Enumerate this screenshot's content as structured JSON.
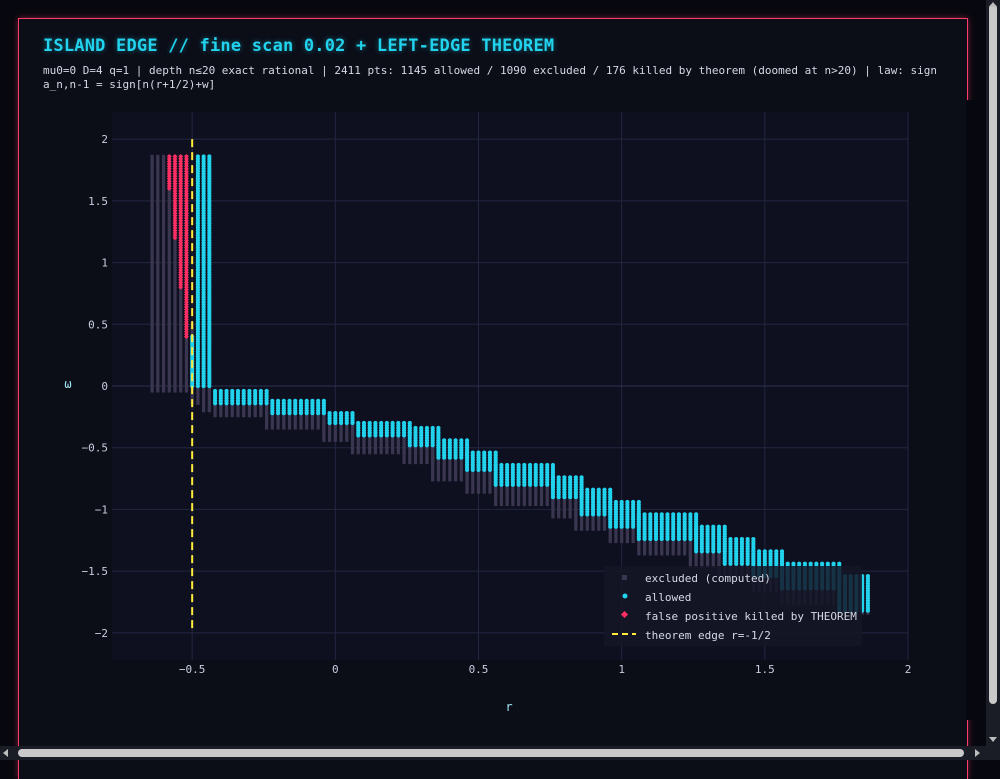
{
  "header": {
    "title": "ISLAND EDGE // fine scan 0.02 + LEFT-EDGE THEOREM",
    "subtitle": "mu0=0 D=4 q=1 | depth n≤20 exact rational | 2411 pts: 1145 allowed / 1090 excluded / 176 killed by theorem (doomed at n>20) | law: sign a_n,n-1 = sign[n(r+1/2)+w]"
  },
  "colors": {
    "excluded": "#3a3650",
    "allowed": "#22d3ee",
    "killed": "#ff2e63",
    "theorem": "#ffeb3b",
    "accent": "#ff3b6b"
  },
  "chart_data": {
    "type": "scatter",
    "title": "ISLAND EDGE // fine scan 0.02 + LEFT-EDGE THEOREM",
    "xlabel": "r",
    "ylabel": "ω",
    "xlim": [
      -0.78,
      2.0
    ],
    "ylim": [
      -2.22,
      2.22
    ],
    "x_ticks": [
      -0.5,
      0,
      0.5,
      1,
      1.5,
      2
    ],
    "x_tick_labels": [
      "−0.5",
      "0",
      "0.5",
      "1",
      "1.5",
      "2"
    ],
    "y_ticks": [
      -2,
      -1.5,
      -1,
      -0.5,
      0,
      0.5,
      1,
      1.5,
      2
    ],
    "y_tick_labels": [
      "−2",
      "−1.5",
      "−1",
      "−0.5",
      "0",
      "0.5",
      "1",
      "1.5",
      "2"
    ],
    "grid": true,
    "legend_position": "bottom-right",
    "scan_step": 0.02,
    "series": [
      {
        "name": "excluded (computed)",
        "marker": "square",
        "color": "#3a3650",
        "segments": [
          {
            "x_start": -0.64,
            "x_end": -0.52,
            "y_min": -0.04,
            "y_max": 1.86
          },
          {
            "x_start": -0.5,
            "x_end": -0.48,
            "y_min": -0.14,
            "y_max": 0.5
          },
          {
            "x_start": -0.46,
            "x_end": -0.44,
            "y_min": -0.2,
            "y_max": 0.0
          },
          {
            "x_start": -0.42,
            "x_end": -0.24,
            "y_min": -0.24,
            "y_max": -0.14
          },
          {
            "x_start": -0.24,
            "x_end": -0.04,
            "y_min": -0.34,
            "y_max": -0.22
          },
          {
            "x_start": -0.04,
            "x_end": 0.06,
            "y_min": -0.44,
            "y_max": -0.3
          },
          {
            "x_start": 0.06,
            "x_end": 0.24,
            "y_min": -0.54,
            "y_max": -0.38
          },
          {
            "x_start": 0.24,
            "x_end": 0.34,
            "y_min": -0.62,
            "y_max": -0.48
          },
          {
            "x_start": 0.34,
            "x_end": 0.46,
            "y_min": -0.76,
            "y_max": -0.56
          },
          {
            "x_start": 0.46,
            "x_end": 0.56,
            "y_min": -0.86,
            "y_max": -0.66
          },
          {
            "x_start": 0.56,
            "x_end": 0.76,
            "y_min": -0.96,
            "y_max": -0.76
          },
          {
            "x_start": 0.76,
            "x_end": 0.84,
            "y_min": -1.06,
            "y_max": -0.86
          },
          {
            "x_start": 0.84,
            "x_end": 0.96,
            "y_min": -1.16,
            "y_max": -0.96
          },
          {
            "x_start": 0.96,
            "x_end": 1.06,
            "y_min": -1.26,
            "y_max": -1.06
          },
          {
            "x_start": 1.06,
            "x_end": 1.24,
            "y_min": -1.36,
            "y_max": -1.16
          },
          {
            "x_start": 1.24,
            "x_end": 1.34,
            "y_min": -1.46,
            "y_max": -1.26
          },
          {
            "x_start": 1.34,
            "x_end": 1.46,
            "y_min": -1.56,
            "y_max": -1.36
          },
          {
            "x_start": 1.46,
            "x_end": 1.56,
            "y_min": -1.66,
            "y_max": -1.46
          },
          {
            "x_start": 1.56,
            "x_end": 1.76,
            "y_min": -1.76,
            "y_max": -1.56
          },
          {
            "x_start": 1.76,
            "x_end": 1.86,
            "y_min": -1.84,
            "y_max": -1.66
          }
        ]
      },
      {
        "name": "allowed",
        "marker": "circle",
        "color": "#22d3ee",
        "segments": [
          {
            "x_start": -0.48,
            "x_end": -0.44,
            "y_min": 0.0,
            "y_max": 1.86
          },
          {
            "x_start": -0.5,
            "x_end": -0.5,
            "y_min": 0.0,
            "y_max": 0.4
          },
          {
            "x_start": -0.42,
            "x_end": -0.24,
            "y_min": -0.14,
            "y_max": -0.04
          },
          {
            "x_start": -0.22,
            "x_end": -0.04,
            "y_min": -0.22,
            "y_max": -0.12
          },
          {
            "x_start": -0.02,
            "x_end": 0.06,
            "y_min": -0.3,
            "y_max": -0.22
          },
          {
            "x_start": 0.08,
            "x_end": 0.26,
            "y_min": -0.4,
            "y_max": -0.3
          },
          {
            "x_start": 0.26,
            "x_end": 0.36,
            "y_min": -0.48,
            "y_max": -0.34
          },
          {
            "x_start": 0.36,
            "x_end": 0.46,
            "y_min": -0.58,
            "y_max": -0.44
          },
          {
            "x_start": 0.46,
            "x_end": 0.56,
            "y_min": -0.68,
            "y_max": -0.54
          },
          {
            "x_start": 0.56,
            "x_end": 0.76,
            "y_min": -0.8,
            "y_max": -0.64
          },
          {
            "x_start": 0.76,
            "x_end": 0.86,
            "y_min": -0.9,
            "y_max": -0.74
          },
          {
            "x_start": 0.86,
            "x_end": 0.96,
            "y_min": -1.04,
            "y_max": -0.84
          },
          {
            "x_start": 0.96,
            "x_end": 1.06,
            "y_min": -1.14,
            "y_max": -0.94
          },
          {
            "x_start": 1.06,
            "x_end": 1.26,
            "y_min": -1.24,
            "y_max": -1.04
          },
          {
            "x_start": 1.26,
            "x_end": 1.36,
            "y_min": -1.34,
            "y_max": -1.14
          },
          {
            "x_start": 1.36,
            "x_end": 1.46,
            "y_min": -1.44,
            "y_max": -1.24
          },
          {
            "x_start": 1.46,
            "x_end": 1.56,
            "y_min": -1.54,
            "y_max": -1.34
          },
          {
            "x_start": 1.56,
            "x_end": 1.76,
            "y_min": -1.64,
            "y_max": -1.44
          },
          {
            "x_start": 1.76,
            "x_end": 1.86,
            "y_min": -1.82,
            "y_max": -1.54
          }
        ]
      },
      {
        "name": "false positive killed by THEOREM",
        "marker": "diamond",
        "color": "#ff2e63",
        "segments": [
          {
            "x_start": -0.58,
            "x_end": -0.58,
            "y_min": 1.6,
            "y_max": 1.86
          },
          {
            "x_start": -0.56,
            "x_end": -0.56,
            "y_min": 1.2,
            "y_max": 1.86
          },
          {
            "x_start": -0.54,
            "x_end": -0.54,
            "y_min": 0.8,
            "y_max": 1.86
          },
          {
            "x_start": -0.52,
            "x_end": -0.52,
            "y_min": 0.4,
            "y_max": 1.86
          }
        ]
      },
      {
        "name": "theorem edge r=-1/2",
        "type": "vline",
        "x": -0.5,
        "style": "dashed",
        "color": "#ffeb3b"
      }
    ]
  }
}
